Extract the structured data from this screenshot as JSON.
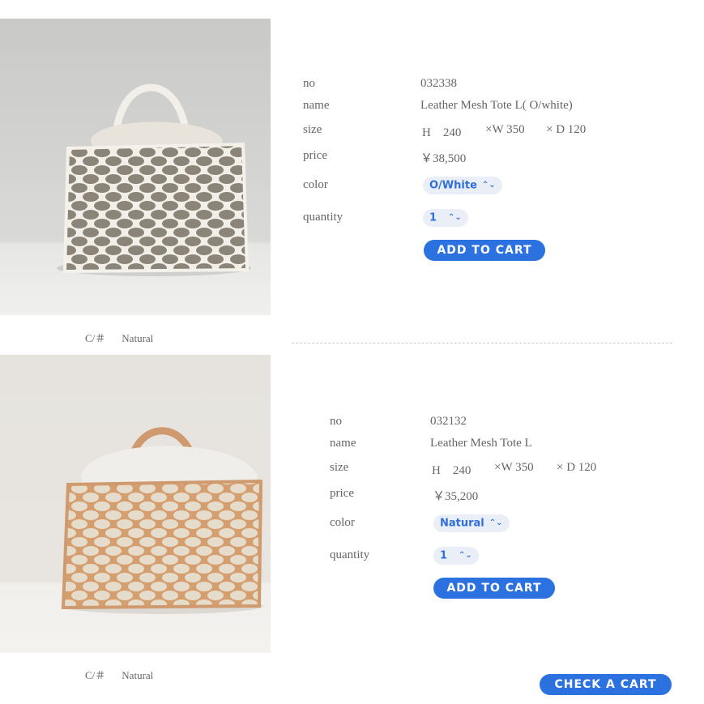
{
  "products": [
    {
      "no_label": "no",
      "no": "032338",
      "name_label": "name",
      "name": "Leather Mesh Tote L( O/white)",
      "size_label": "size",
      "size_h": "H　240",
      "size_w": "×W 350",
      "size_d": "× D 120",
      "price_label": "price",
      "price": "￥38,500",
      "color_label": "color",
      "color": "O/White",
      "quantity_label": "quantity",
      "quantity": "1",
      "add_label": "ADD TO CART",
      "caption_c": "C/＃",
      "caption_color": "Natural",
      "bag_color": "#efece6",
      "bg_color": "#d6d6d4"
    },
    {
      "no_label": "no",
      "no": "032132",
      "name_label": "name",
      "name": "Leather Mesh Tote L",
      "size_label": "size",
      "size_h": "H　240",
      "size_w": "×W 350",
      "size_d": "× D 120",
      "price_label": "price",
      "price": "￥35,200",
      "color_label": "color",
      "color": "Natural",
      "quantity_label": "quantity",
      "quantity": "1",
      "add_label": "ADD TO CART",
      "caption_c": "C/＃",
      "caption_color": "Natural",
      "bag_color": "#cf9a6d",
      "bg_color": "#e8e5e0"
    }
  ],
  "check_cart_label": "CHECK A CART",
  "icons": {
    "select": "chevron-updown-icon"
  }
}
